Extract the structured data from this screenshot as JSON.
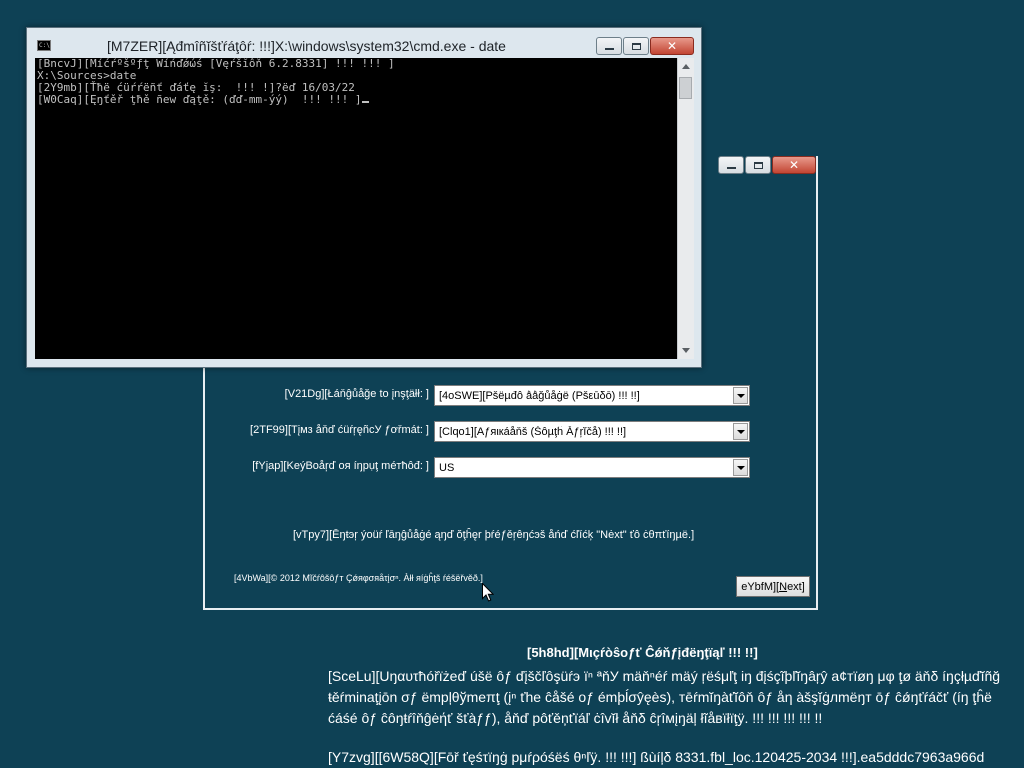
{
  "setup": {
    "language_label": "[V21Dg][Łáňĝůåğe to įnşţäłł: ]",
    "language_value": "[4oSWE][Pšëµđô ǻǻğůåġë (Pšεūδō) !!! !!]",
    "time_label": "[2TF99][Tįмз åňď ćüŕŗęñcУ ƒơřmát: ]",
    "time_value": "[Clqo1][Αƒяιкáåňš (Šôµţĥ Ăƒŗĭčå) !!! !!]",
    "keyboard_label": "[fYjap][KeýBoåŗď оя íŋpụţ méтħôđ: ]",
    "keyboard_value": "US",
    "instruction": "[vTpy7][Ēŋŧэŗ ýoüŕ ľāŋĝůåġé ąŋď ŏţĥęr þŕéƒěŗêŋćэš åńď ćľíćķ \"Nėxt\" ťô ċθπťíŋµë.]",
    "copyright": "[4VbWa][© 2012 Mĩčŕôšôƒт Çǿяφσяåτįσⁿ. Àłł яíġĥţš ŕéšëřvěð.]",
    "next_prefix": "eYbfM][",
    "next_accel": "N",
    "next_suffix": "ext]"
  },
  "cmd": {
    "title": "[M7ZER][Ąđmîñĭšťŕáţôŕ:  !!!]X:\\windows\\system32\\cmd.exe - date",
    "icon_text": "C:\\",
    "lines": [
      "[BncvJ][Μíćŕºšºƒţ Wíńďǿώś [Vęŕšĭôň 6.2.8331] !!! !!! ]",
      "",
      "",
      "X:\\Sources>date",
      "[2Y9mb][Ťħë ćüŕŕëñť ďáťę ĭş:  !!! !]?ëď 16/03/22",
      "[W0Caq][Ęŋťěř ţħě ñеw ďąţě: (ďď-mm-ýý)  !!! !!! ]"
    ]
  },
  "watermark": {
    "title": "[5h8hd][Mιçŕòŝoƒť Ĉǿňƒįđëŋţïąľ !!! !!]",
    "body": "[SceLu][Uŋαυτħóřïżеď úšë ôƒ ďįščľôşüŕэ ïⁿ ªňУ mäňⁿéŕ mäý ŗëśμľţ iŋ đįśçĩþľĭŋâŗŷ a¢тïøŋ μφ ţø äňδ íŋçłµďĭñğ ŧěŕminaţįōn σƒ ёmpļθўmeπţ (įⁿ ťhe ĉåšé oƒ émþĺσŷęès), тēŕmĭŋàťĭôň ôƒ åη àšşĭġлmëŋт ōƒ ĉǿŋťŕáčť (íŋ ţĥë ćáśé ôƒ ĉôŋŧŕîňĝėήť šťàƒƒ), åňď pôťěņťïáľ ċîvĭł åňδ ĉŗîмįŋäļ łĩåвïłïţÿ. !!! !!! !!! !!! !!",
    "build": "[Y7zvg][[6W58Q][Fōř ťęśτïŋġ pμŕρóśëś θⁿľÿ. !!! !!!] ßùíļδ 8331.fbl_loc.120425-2034 !!!].ea5dddc7963a966d"
  },
  "icons": {
    "minimize": "minimize-icon",
    "maximize": "maximize-icon",
    "close": "close-icon",
    "dropdown": "chevron-down-icon",
    "cmd": "command-prompt-icon",
    "cursor": "mouse-pointer-icon"
  },
  "colors": {
    "desktop": "#0e4155",
    "console_bg": "#000000",
    "console_text": "#c0c0c0",
    "close_button": "#c24533"
  }
}
